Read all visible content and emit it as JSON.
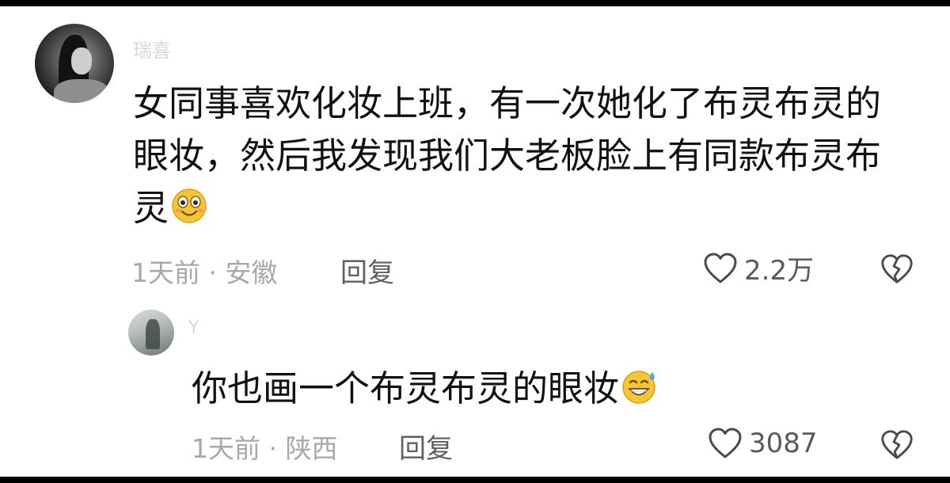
{
  "comment": {
    "username": "瑞喜",
    "text_line1": "女同事喜欢化妆上班，有一次她化了布灵布灵的",
    "text_line2": "眼妆，然后我发现我们大老板脸上有同款布灵布",
    "text_line3": "灵",
    "emoji": "smiling-face-emoji",
    "time": "1天前",
    "separator": " · ",
    "location": "安徽",
    "reply_label": "回复",
    "like_count": "2.2万"
  },
  "reply": {
    "username": "Y",
    "text": "你也画一个布灵布灵的眼妆",
    "emoji": "grinning-sweat-emoji",
    "time": "1天前",
    "separator": " · ",
    "location": "陕西",
    "reply_label": "回复",
    "like_count": "3087"
  },
  "colors": {
    "background": "#ffffff",
    "text": "#111111",
    "meta": "#a8a8a8",
    "emoji_yellow": "#f7c531"
  }
}
